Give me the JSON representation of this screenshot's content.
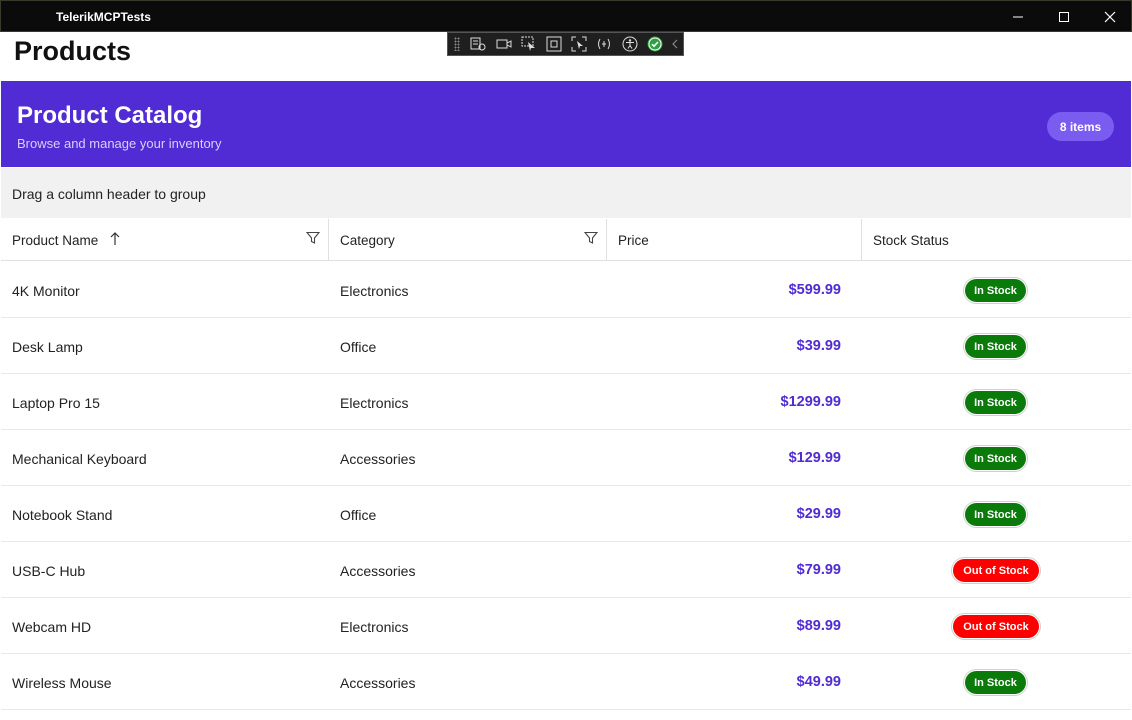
{
  "window": {
    "title": "TelerikMCPTests"
  },
  "page": {
    "title": "Products"
  },
  "banner": {
    "title": "Product Catalog",
    "subtitle": "Browse and manage your inventory",
    "count_badge": "8 items"
  },
  "grid": {
    "group_hint": "Drag a column header to group",
    "columns": [
      {
        "label": "Product Name",
        "sorted": "ascending",
        "filterable": true
      },
      {
        "label": "Category",
        "filterable": true
      },
      {
        "label": "Price"
      },
      {
        "label": "Stock Status"
      }
    ],
    "rows": [
      {
        "name": "4K Monitor",
        "category": "Electronics",
        "price": "$599.99",
        "status": "In Stock"
      },
      {
        "name": "Desk Lamp",
        "category": "Office",
        "price": "$39.99",
        "status": "In Stock"
      },
      {
        "name": "Laptop Pro 15",
        "category": "Electronics",
        "price": "$1299.99",
        "status": "In Stock"
      },
      {
        "name": "Mechanical Keyboard",
        "category": "Accessories",
        "price": "$129.99",
        "status": "In Stock"
      },
      {
        "name": "Notebook Stand",
        "category": "Office",
        "price": "$29.99",
        "status": "In Stock"
      },
      {
        "name": "USB-C Hub",
        "category": "Accessories",
        "price": "$79.99",
        "status": "Out of Stock"
      },
      {
        "name": "Webcam HD",
        "category": "Electronics",
        "price": "$89.99",
        "status": "Out of Stock"
      },
      {
        "name": "Wireless Mouse",
        "category": "Accessories",
        "price": "$49.99",
        "status": "In Stock"
      }
    ]
  },
  "colors": {
    "accent": "#512bd4",
    "in_stock": "#0a7a0a",
    "out_of_stock": "#ff0000"
  },
  "icons": {
    "toolbar": [
      "live-visual-tree-icon",
      "record-icon",
      "select-element-icon",
      "display-layout-adorners-icon",
      "track-focus-icon",
      "binding-failures-icon",
      "accessibility-icon",
      "check-icon",
      "collapse-icon"
    ],
    "sort": "arrow-up-icon",
    "filter": "filter-icon"
  }
}
